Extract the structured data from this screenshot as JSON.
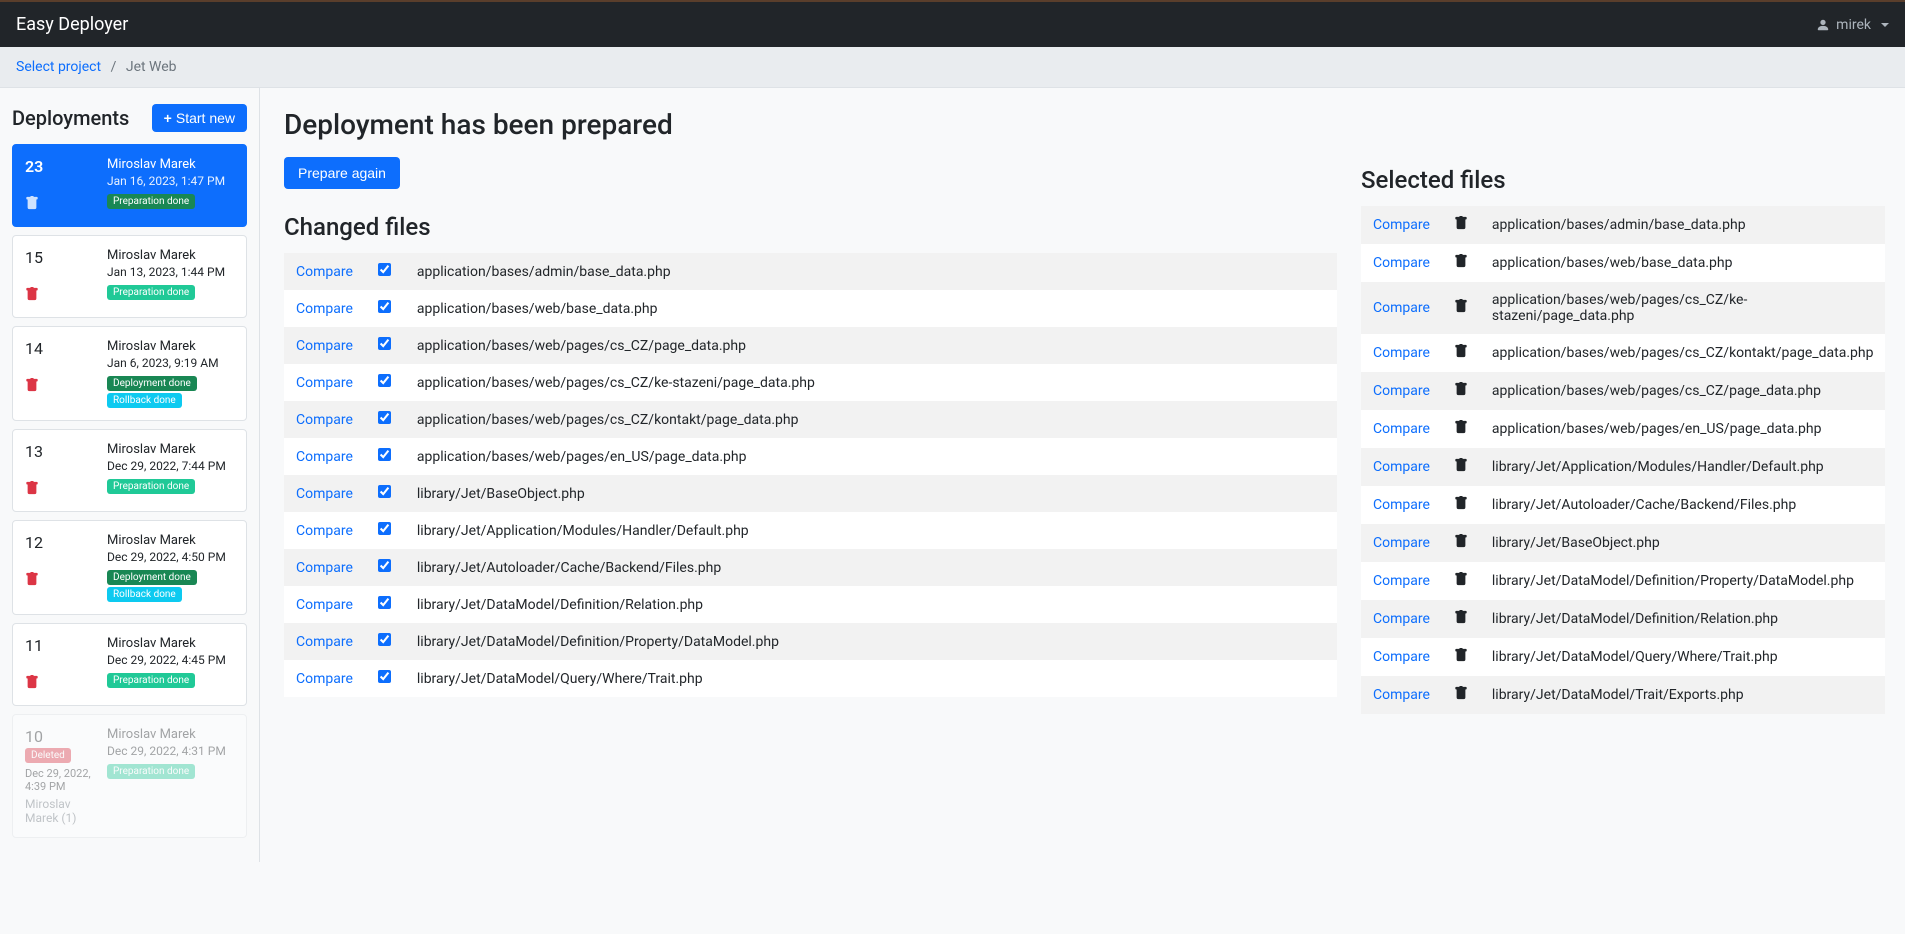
{
  "navbar": {
    "brand": "Easy Deployer",
    "user": "mirek"
  },
  "breadcrumb": {
    "link_text": "Select project",
    "current": "Jet Web"
  },
  "sidebar": {
    "title": "Deployments",
    "start_new": "Start new",
    "items": [
      {
        "id": "23",
        "author": "Miroslav Marek",
        "date": "Jan 16, 2023, 1:47 PM",
        "badges": [
          "Preparation done"
        ],
        "badge_types": [
          "prep"
        ],
        "active": true
      },
      {
        "id": "15",
        "author": "Miroslav Marek",
        "date": "Jan 13, 2023, 1:44 PM",
        "badges": [
          "Preparation done"
        ],
        "badge_types": [
          "prep"
        ]
      },
      {
        "id": "14",
        "author": "Miroslav Marek",
        "date": "Jan 6, 2023, 9:19 AM",
        "badges": [
          "Deployment done",
          "Rollback done"
        ],
        "badge_types": [
          "deploy",
          "rollback"
        ]
      },
      {
        "id": "13",
        "author": "Miroslav Marek",
        "date": "Dec 29, 2022, 7:44 PM",
        "badges": [
          "Preparation done"
        ],
        "badge_types": [
          "prep"
        ]
      },
      {
        "id": "12",
        "author": "Miroslav Marek",
        "date": "Dec 29, 2022, 4:50 PM",
        "badges": [
          "Deployment done",
          "Rollback done"
        ],
        "badge_types": [
          "deploy",
          "rollback"
        ]
      },
      {
        "id": "11",
        "author": "Miroslav Marek",
        "date": "Dec 29, 2022, 4:45 PM",
        "badges": [
          "Preparation done"
        ],
        "badge_types": [
          "prep"
        ]
      }
    ],
    "faded_item": {
      "id": "10",
      "deleted_badge": "Deleted",
      "author": "Miroslav Marek",
      "date": "Dec 29, 2022, 4:31 PM",
      "left_date": "Dec 29, 2022, 4:39 PM",
      "footer": "Miroslav Marek (1)",
      "badge": "Preparation done"
    }
  },
  "main": {
    "title": "Deployment has been prepared",
    "prepare_again": "Prepare again",
    "changed_title": "Changed files",
    "compare_label": "Compare",
    "changed_files": [
      "application/bases/admin/base_data.php",
      "application/bases/web/base_data.php",
      "application/bases/web/pages/cs_CZ/page_data.php",
      "application/bases/web/pages/cs_CZ/ke-stazeni/page_data.php",
      "application/bases/web/pages/cs_CZ/kontakt/page_data.php",
      "application/bases/web/pages/en_US/page_data.php",
      "library/Jet/BaseObject.php",
      "library/Jet/Application/Modules/Handler/Default.php",
      "library/Jet/Autoloader/Cache/Backend/Files.php",
      "library/Jet/DataModel/Definition/Relation.php",
      "library/Jet/DataModel/Definition/Property/DataModel.php",
      "library/Jet/DataModel/Query/Where/Trait.php"
    ],
    "selected_title": "Selected files",
    "selected_files": [
      "application/bases/admin/base_data.php",
      "application/bases/web/base_data.php",
      "application/bases/web/pages/cs_CZ/ke-stazeni/page_data.php",
      "application/bases/web/pages/cs_CZ/kontakt/page_data.php",
      "application/bases/web/pages/cs_CZ/page_data.php",
      "application/bases/web/pages/en_US/page_data.php",
      "library/Jet/Application/Modules/Handler/Default.php",
      "library/Jet/Autoloader/Cache/Backend/Files.php",
      "library/Jet/BaseObject.php",
      "library/Jet/DataModel/Definition/Property/DataModel.php",
      "library/Jet/DataModel/Definition/Relation.php",
      "library/Jet/DataModel/Query/Where/Trait.php",
      "library/Jet/DataModel/Trait/Exports.php"
    ]
  }
}
